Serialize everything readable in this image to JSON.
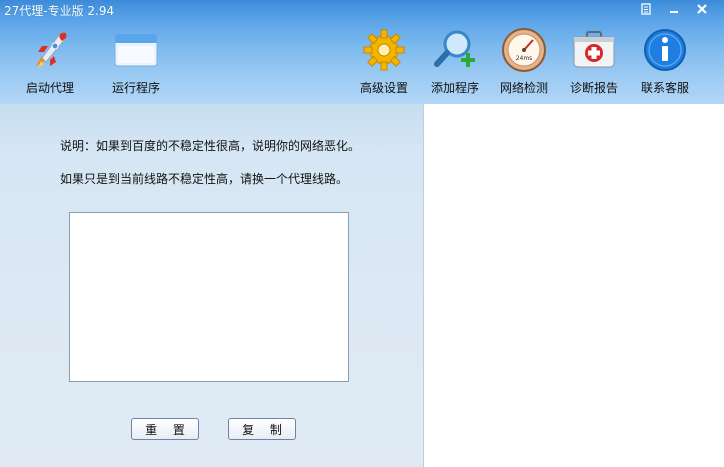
{
  "window": {
    "title": "27代理-专业版 2.94"
  },
  "toolbar": {
    "left": [
      {
        "label": "启动代理",
        "icon": "rocket-icon"
      },
      {
        "label": "运行程序",
        "icon": "window-icon"
      }
    ],
    "right": [
      {
        "label": "高级设置",
        "icon": "gear-icon"
      },
      {
        "label": "添加程序",
        "icon": "magnifier-plus-icon"
      },
      {
        "label": "网络检测",
        "icon": "gauge-icon",
        "gauge_text": "24ms"
      },
      {
        "label": "诊断报告",
        "icon": "first-aid-kit-icon"
      },
      {
        "label": "联系客服",
        "icon": "info-icon"
      }
    ]
  },
  "content": {
    "note1": "说明：如果到百度的不稳定性很高，说明你的网络恶化。",
    "note2": "如果只是到当前线路不稳定性高，请换一个代理线路。",
    "log_text": "",
    "reset_label": "重 置",
    "copy_label": "复 制"
  },
  "colors": {
    "title_bar": "#3c8ad8",
    "toolbar_bottom": "#b3d6f6",
    "panel": "#dde9f4"
  }
}
